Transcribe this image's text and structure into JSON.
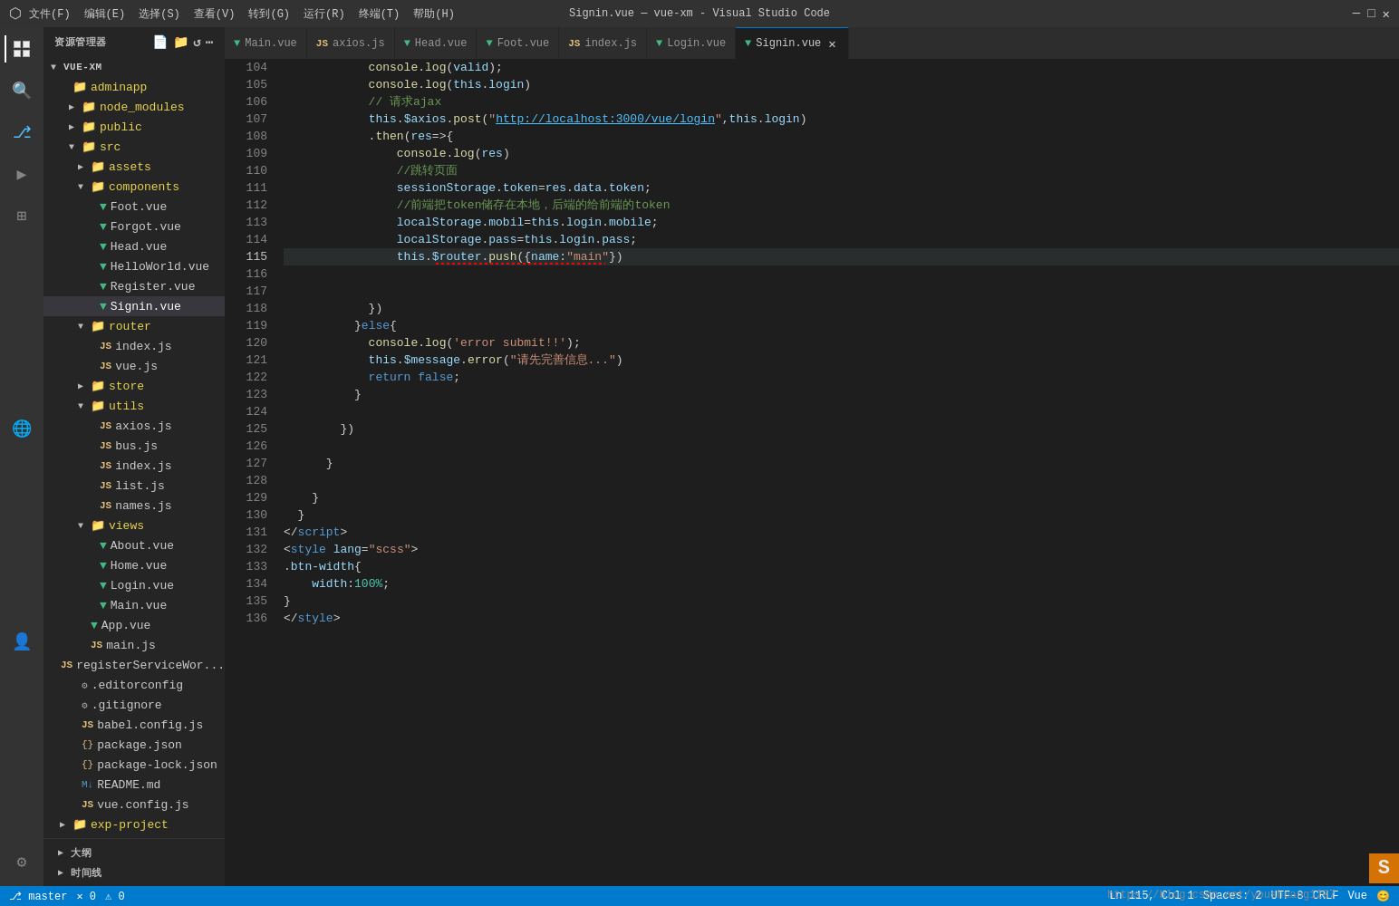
{
  "titleBar": {
    "title": "Signin.vue — vue-xm - Visual Studio Code",
    "menus": [
      "文件(F)",
      "编辑(E)",
      "选择(S)",
      "查看(V)",
      "转到(G)",
      "运行(R)",
      "终端(T)",
      "帮助(H)"
    ]
  },
  "sidebar": {
    "header": "资源管理器",
    "root": "VUE-XM",
    "items": [
      {
        "label": "adminapp",
        "type": "folder",
        "indent": 1
      },
      {
        "label": "node_modules",
        "type": "folder",
        "indent": 2,
        "arrow": "▶"
      },
      {
        "label": "public",
        "type": "folder",
        "indent": 2,
        "arrow": "▶"
      },
      {
        "label": "src",
        "type": "folder",
        "indent": 2,
        "arrow": "▼"
      },
      {
        "label": "assets",
        "type": "folder",
        "indent": 3,
        "arrow": "▶"
      },
      {
        "label": "components",
        "type": "folder",
        "indent": 3,
        "arrow": "▼"
      },
      {
        "label": "Foot.vue",
        "type": "vue",
        "indent": 4
      },
      {
        "label": "Forgot.vue",
        "type": "vue",
        "indent": 4
      },
      {
        "label": "Head.vue",
        "type": "vue",
        "indent": 4
      },
      {
        "label": "HelloWorld.vue",
        "type": "vue",
        "indent": 4
      },
      {
        "label": "Register.vue",
        "type": "vue",
        "indent": 4
      },
      {
        "label": "Signin.vue",
        "type": "vue",
        "indent": 4,
        "active": true
      },
      {
        "label": "router",
        "type": "folder",
        "indent": 3,
        "arrow": "▼"
      },
      {
        "label": "index.js",
        "type": "js",
        "indent": 4
      },
      {
        "label": "vue.js",
        "type": "js",
        "indent": 4
      },
      {
        "label": "store",
        "type": "folder",
        "indent": 3,
        "arrow": "▶"
      },
      {
        "label": "utils",
        "type": "folder",
        "indent": 3,
        "arrow": "▼"
      },
      {
        "label": "axios.js",
        "type": "js",
        "indent": 4
      },
      {
        "label": "bus.js",
        "type": "js",
        "indent": 4
      },
      {
        "label": "index.js",
        "type": "js",
        "indent": 4
      },
      {
        "label": "list.js",
        "type": "js",
        "indent": 4
      },
      {
        "label": "names.js",
        "type": "js",
        "indent": 4
      },
      {
        "label": "views",
        "type": "folder",
        "indent": 3,
        "arrow": "▼"
      },
      {
        "label": "About.vue",
        "type": "vue",
        "indent": 4
      },
      {
        "label": "Home.vue",
        "type": "vue",
        "indent": 4
      },
      {
        "label": "Login.vue",
        "type": "vue",
        "indent": 4
      },
      {
        "label": "Main.vue",
        "type": "vue",
        "indent": 4
      },
      {
        "label": "App.vue",
        "type": "vue",
        "indent": 3
      },
      {
        "label": "main.js",
        "type": "js",
        "indent": 3
      },
      {
        "label": "registerServiceWor...",
        "type": "js",
        "indent": 3
      },
      {
        "label": ".editorconfig",
        "type": "dot",
        "indent": 2
      },
      {
        "label": ".gitignore",
        "type": "dot",
        "indent": 2
      },
      {
        "label": "babel.config.js",
        "type": "js",
        "indent": 2
      },
      {
        "label": "package.json",
        "type": "json",
        "indent": 2
      },
      {
        "label": "package-lock.json",
        "type": "json",
        "indent": 2
      },
      {
        "label": "README.md",
        "type": "md",
        "indent": 2
      },
      {
        "label": "vue.config.js",
        "type": "js",
        "indent": 2
      },
      {
        "label": "exp-project",
        "type": "folder",
        "indent": 1,
        "arrow": "▶"
      }
    ],
    "bottomItems": [
      "大纲",
      "时间线"
    ]
  },
  "tabs": [
    {
      "label": "Main.vue",
      "type": "vue",
      "active": false
    },
    {
      "label": "axios.js",
      "type": "js",
      "active": false
    },
    {
      "label": "Head.vue",
      "type": "vue",
      "active": false
    },
    {
      "label": "Foot.vue",
      "type": "vue",
      "active": false
    },
    {
      "label": "index.js",
      "type": "js",
      "active": false
    },
    {
      "label": "Login.vue",
      "type": "vue",
      "active": false
    },
    {
      "label": "Signin.vue",
      "type": "vue",
      "active": true,
      "closable": true
    }
  ],
  "lineNumbers": [
    104,
    105,
    106,
    107,
    108,
    109,
    110,
    111,
    112,
    113,
    114,
    115,
    116,
    117,
    118,
    119,
    120,
    121,
    122,
    123,
    124,
    125,
    126,
    127,
    128,
    129,
    130,
    131,
    132,
    133,
    134,
    135,
    136
  ],
  "statusBar": {
    "branch": "master",
    "errors": "0",
    "warnings": "0",
    "line": "Ln 115, Col 1",
    "spaces": "Spaces: 2",
    "encoding": "UTF-8",
    "crlf": "CRLF",
    "language": "Vue",
    "feedback": "😊"
  },
  "watermark": "S",
  "csdnLink": "https://blog.csdn.net/youshuang1207"
}
